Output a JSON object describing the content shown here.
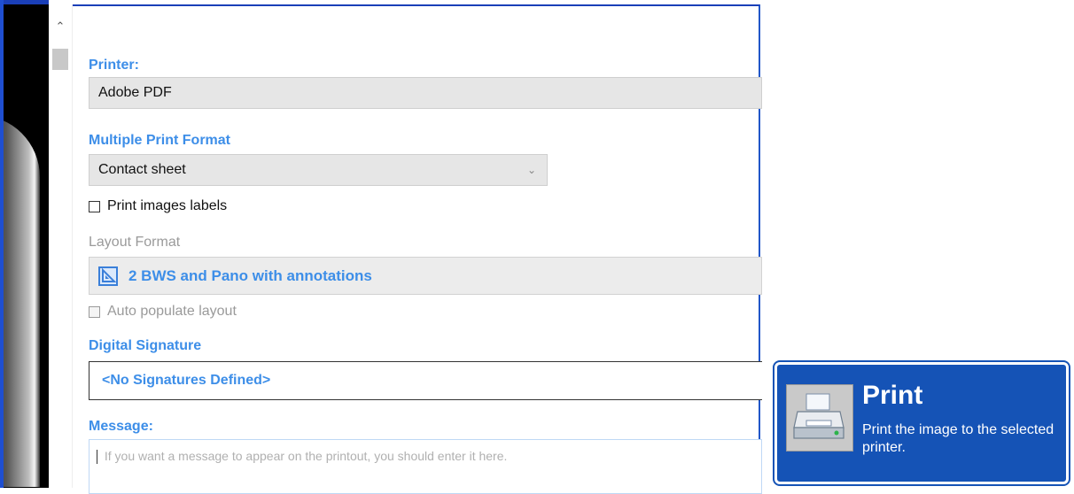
{
  "scrollbar": {
    "up_icon": "chevron-up-icon"
  },
  "printer": {
    "label": "Printer:",
    "value": "Adobe PDF"
  },
  "multiple_print_format": {
    "label": "Multiple Print Format",
    "selected": "Contact sheet"
  },
  "print_images_labels": {
    "label": "Print images labels",
    "checked": false
  },
  "layout_format": {
    "label": "Layout Format",
    "value": "2 BWS and Pano with annotations",
    "icon": "layout-template-icon"
  },
  "auto_populate_layout": {
    "label": "Auto populate layout",
    "checked": false,
    "enabled": false
  },
  "digital_signature": {
    "label": "Digital Signature",
    "value": "<No Signatures Defined>"
  },
  "message": {
    "label": "Message:",
    "placeholder": "If you want a message to appear on the printout, you should enter it here."
  },
  "print_button": {
    "title": "Print",
    "description": "Print the image to the selected printer.",
    "icon": "printer-icon"
  },
  "colors": {
    "label_blue": "#3d8ee8",
    "print_button_bg": "#1553b6",
    "field_bg": "#e6e6e6"
  }
}
